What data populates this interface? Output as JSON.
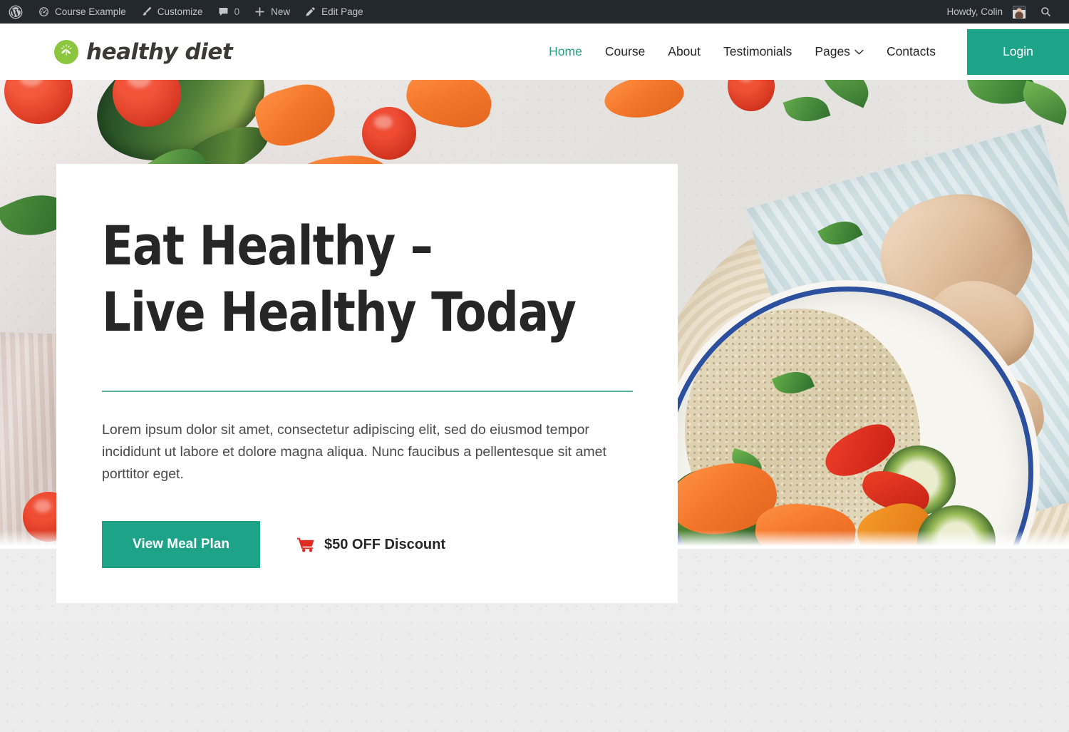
{
  "adminbar": {
    "wp_logo_icon": "wordpress-logo-icon",
    "left_items": [
      {
        "icon": "dashboard-icon",
        "label": "Course Example"
      },
      {
        "icon": "paintbrush-icon",
        "label": "Customize"
      },
      {
        "icon": "comment-bubble-icon",
        "label": "0"
      },
      {
        "icon": "plus-icon",
        "label": "New"
      },
      {
        "icon": "pencil-icon",
        "label": "Edit Page"
      }
    ],
    "howdy": "Howdy, Colin",
    "avatar_icon": "user-avatar",
    "search_icon": "search-icon"
  },
  "header": {
    "logo_icon": "leaf-sprout-logo-icon",
    "brand": "healthy diet",
    "nav": [
      {
        "label": "Home",
        "active": true,
        "dropdown": false
      },
      {
        "label": "Course",
        "active": false,
        "dropdown": false
      },
      {
        "label": "About",
        "active": false,
        "dropdown": false
      },
      {
        "label": "Testimonials",
        "active": false,
        "dropdown": false
      },
      {
        "label": "Pages",
        "active": false,
        "dropdown": true
      },
      {
        "label": "Contacts",
        "active": false,
        "dropdown": false
      }
    ],
    "dropdown_icon": "chevron-down-icon",
    "login_label": "Login"
  },
  "hero": {
    "title": "Eat Healthy –\nLive Healthy Today",
    "description": "Lorem ipsum dolor sit amet, consectetur adipiscing elit, sed do eiusmod tempor incididunt ut labore et dolore magna aliqua. Nunc faucibus a pellentesque sit amet porttitor eget.",
    "primary_button": "View Meal Plan",
    "secondary_link": "$50 OFF Discount",
    "cart_icon": "shopping-cart-icon",
    "photo_alt": "Bowl of quinoa with roasted vegetables, ginger root, tomatoes and herbs on marble"
  },
  "colors": {
    "accent_teal": "#1da388",
    "nav_active": "#25a180",
    "divider": "#5ab3a0",
    "cart_red": "#e02b20",
    "logo_green": "#8cc63e",
    "adminbar_bg": "#23282d",
    "heading": "#262626",
    "page_bg": "#ededed"
  }
}
